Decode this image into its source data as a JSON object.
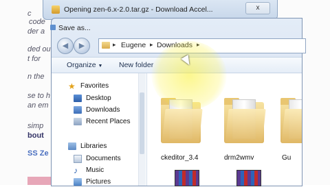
{
  "background_page": {
    "lines": [
      "c",
      "code",
      "der a",
      "ded ou",
      "t for",
      "n the",
      "se to h",
      "an em",
      "simp",
      "bout",
      "SS Ze"
    ]
  },
  "download_window": {
    "title": "Opening zen-6.x-2.0.tar.gz - Download Accel...",
    "close": "x"
  },
  "dialog": {
    "title": "Save as...",
    "address": {
      "crumbs": [
        "Eugene",
        "Downloads"
      ]
    },
    "toolbar": {
      "organize": "Organize",
      "new_folder": "New folder"
    },
    "nav": {
      "favorites": "Favorites",
      "favorite_items": [
        "Desktop",
        "Downloads",
        "Recent Places"
      ],
      "libraries": "Libraries",
      "library_items": [
        "Documents",
        "Music",
        "Pictures"
      ]
    },
    "folders": [
      "ckeditor_3.4",
      "drm2wmv",
      "Gu"
    ]
  },
  "icons": [
    "back-icon",
    "forward-icon",
    "folder-icon",
    "star-icon",
    "desktop-icon",
    "downloads-icon",
    "recent-places-icon",
    "library-icon",
    "documents-icon",
    "music-icon",
    "pictures-icon",
    "winrar-icon",
    "cursor-icon"
  ]
}
